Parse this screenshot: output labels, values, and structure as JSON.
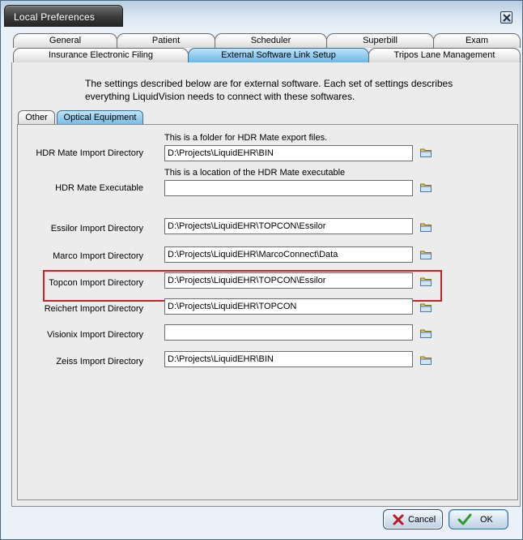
{
  "window": {
    "title": "Local Preferences",
    "close_icon": "close-icon"
  },
  "tabs_row1": [
    "General",
    "Patient",
    "Scheduler",
    "Superbill",
    "Exam"
  ],
  "tabs_row2": [
    "Insurance Electronic Filing",
    "External Software Link Setup",
    "Tripos Lane Management"
  ],
  "info_text": "The settings described below are for external software.  Each set of settings describes everything LiquidVision needs to connect with these softwares.",
  "subtabs": [
    "Other",
    "Optical Equipment"
  ],
  "fields": [
    {
      "label": "HDR Mate Import Directory",
      "hint": "This is a folder for HDR Mate export files.",
      "value": "D:\\Projects\\LiquidEHR\\BIN"
    },
    {
      "label": "HDR Mate Executable",
      "hint": "This is a location of the HDR Mate executable",
      "value": ""
    },
    {
      "label": "Essilor Import Directory",
      "hint": "",
      "value": "D:\\Projects\\LiquidEHR\\TOPCON\\Essilor"
    },
    {
      "label": "Marco Import Directory",
      "hint": "",
      "value": "D:\\Projects\\LiquidEHR\\MarcoConnect\\Data"
    },
    {
      "label": "Topcon Import Directory",
      "hint": "",
      "value": "D:\\Projects\\LiquidEHR\\TOPCON\\Essilor"
    },
    {
      "label": "Reichert Import Directory",
      "hint": "",
      "value": "D:\\Projects\\LiquidEHR\\TOPCON"
    },
    {
      "label": "Visionix Import Directory",
      "hint": "",
      "value": ""
    },
    {
      "label": "Zeiss Import Directory",
      "hint": "",
      "value": "D:\\Projects\\LiquidEHR\\BIN"
    }
  ],
  "buttons": {
    "cancel": "Cancel",
    "ok": "OK"
  },
  "colors": {
    "highlight": "#c42428",
    "active_tab": "#8ecbef",
    "title_bar": "#3b3b3b"
  }
}
